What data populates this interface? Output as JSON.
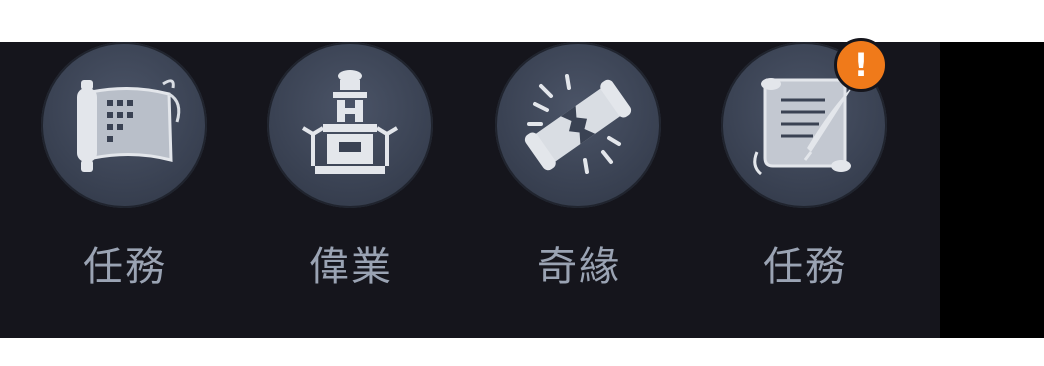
{
  "menu": {
    "items": [
      {
        "label": "任務",
        "icon": "scroll-icon",
        "has_badge": false
      },
      {
        "label": "偉業",
        "icon": "monument-icon",
        "has_badge": false
      },
      {
        "label": "奇緣",
        "icon": "burst-scroll-icon",
        "has_badge": false
      },
      {
        "label": "任務",
        "icon": "quill-scroll-icon",
        "has_badge": true,
        "badge_text": "!"
      }
    ]
  },
  "colors": {
    "bar_background": "#15151c",
    "circle": "#3a4253",
    "label": "#9aa3b3",
    "icon": "#d9dde3",
    "badge": "#f07a1a"
  }
}
